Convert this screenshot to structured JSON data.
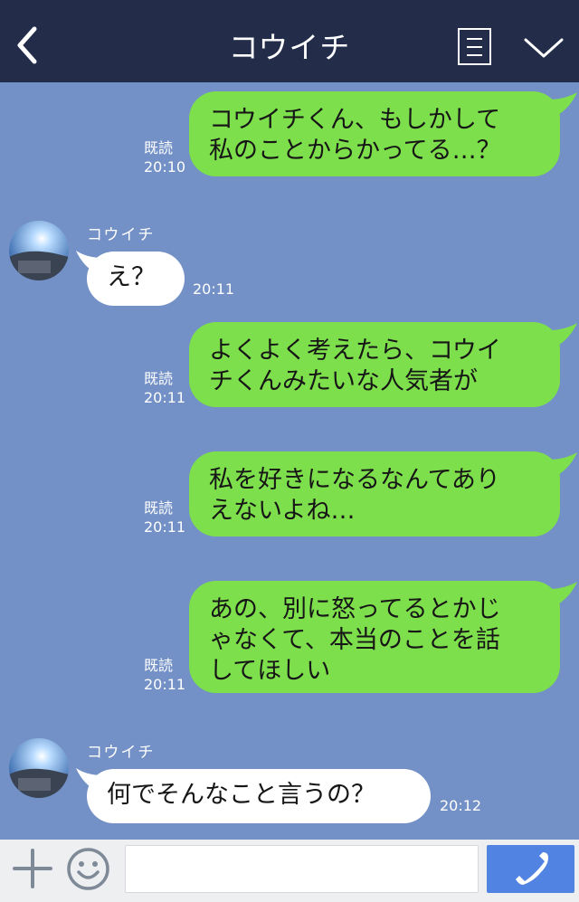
{
  "header": {
    "title": "コウイチ",
    "bg_color": "#232d4a"
  },
  "chat": {
    "bg_color": "#7391c6",
    "outgoing_bubble_color": "#7edf4c",
    "incoming_bubble_color": "#ffffff",
    "messages": [
      {
        "direction": "out",
        "lines": [
          "コウイチくん、もしかして",
          "私のことからかってる…？"
        ],
        "read": "既読",
        "time": "20:10"
      },
      {
        "direction": "in",
        "sender": "コウイチ",
        "lines": [
          "え？"
        ],
        "time": "20:11"
      },
      {
        "direction": "out",
        "lines": [
          "よくよく考えたら、コウイ",
          "チくんみたいな人気者が"
        ],
        "read": "既読",
        "time": "20:11"
      },
      {
        "direction": "out",
        "lines": [
          "私を好きになるなんてあり",
          "えないよね…"
        ],
        "read": "既読",
        "time": "20:11"
      },
      {
        "direction": "out",
        "lines": [
          "あの、別に怒ってるとかじ",
          "ゃなくて、本当のことを話",
          "してほしい"
        ],
        "read": "既読",
        "time": "20:11"
      },
      {
        "direction": "in",
        "sender": "コウイチ",
        "lines": [
          "何でそんなこと言うの？"
        ],
        "time": "20:12"
      }
    ]
  },
  "footer": {
    "input_value": "",
    "call_button_color": "#5183e3"
  },
  "icons": {
    "back": "back-chevron-icon",
    "menu": "list-menu-icon",
    "collapse": "chevron-down-icon",
    "add": "plus-icon",
    "emoji": "smiley-icon",
    "call": "phone-icon"
  }
}
